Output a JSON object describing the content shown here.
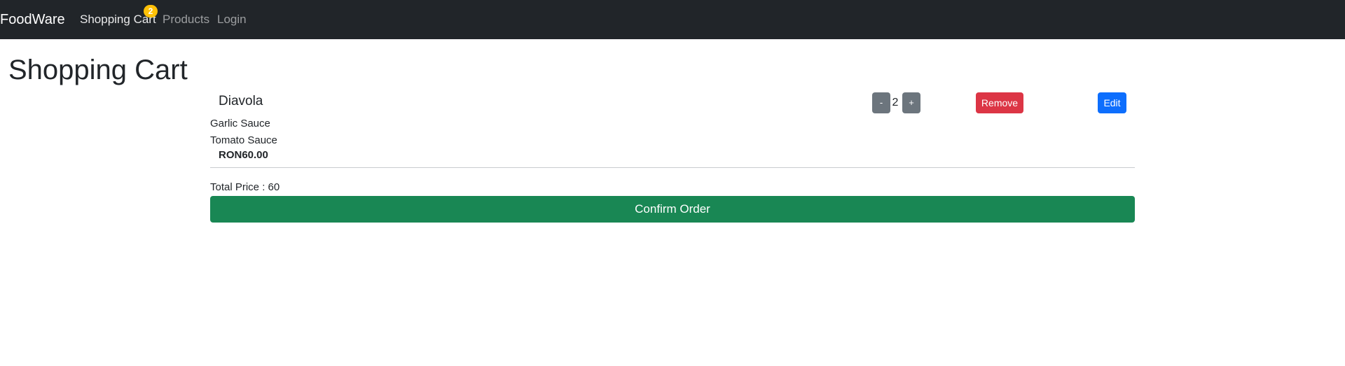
{
  "navbar": {
    "brand": "FoodWare",
    "links": [
      {
        "label": "Shopping Cart",
        "active": true
      },
      {
        "label": "Products",
        "active": false
      },
      {
        "label": "Login",
        "active": false
      }
    ],
    "cart_badge": "2"
  },
  "page": {
    "title": "Shopping Cart"
  },
  "cart": {
    "items": [
      {
        "name": "Diavola",
        "options": [
          "Garlic Sauce",
          "Tomato Sauce"
        ],
        "price": "RON60.00",
        "quantity": "2",
        "decrement_label": "-",
        "increment_label": "+",
        "remove_label": "Remove",
        "edit_label": "Edit"
      }
    ],
    "total_label": "Total Price : 60",
    "confirm_label": "Confirm Order"
  },
  "colors": {
    "navbar_bg": "#212529",
    "badge": "#ffc107",
    "qty_button": "#6c757d",
    "remove_button": "#dc3545",
    "edit_button": "#0d6efd",
    "confirm_button": "#198754"
  }
}
